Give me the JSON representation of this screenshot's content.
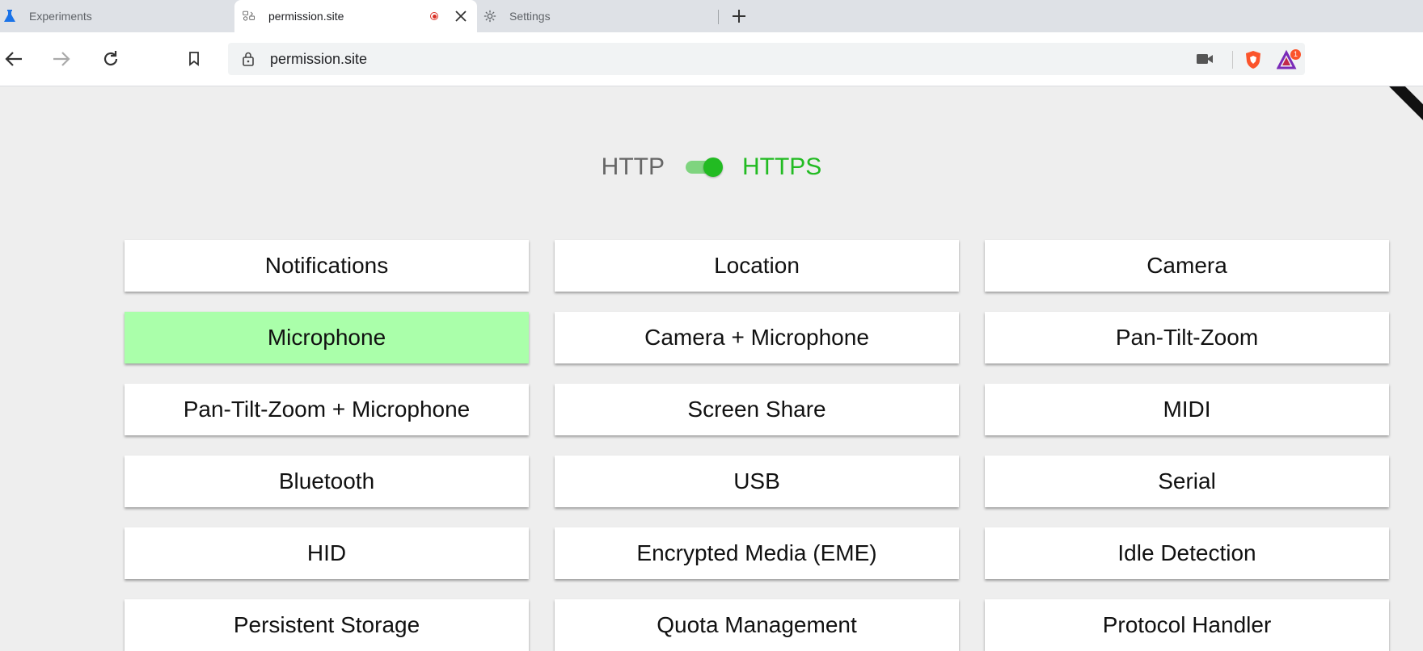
{
  "browser": {
    "tabs": [
      {
        "label": "Experiments",
        "icon": "flask-icon"
      },
      {
        "label": "permission.site",
        "icon": "site-icon",
        "active": true,
        "recording": true
      },
      {
        "label": "Settings",
        "icon": "gear-icon"
      }
    ],
    "address": "permission.site",
    "colors": {
      "recording": "#d93025",
      "brave": "#fb542b"
    },
    "rewards_badge": "1"
  },
  "page": {
    "protocol": {
      "http_label": "HTTP",
      "https_label": "HTTPS",
      "active": "HTTPS"
    },
    "accent_color": "#22bb22",
    "granted_color": "#aaffaa",
    "permissions": [
      {
        "label": "Notifications",
        "granted": false
      },
      {
        "label": "Location",
        "granted": false
      },
      {
        "label": "Camera",
        "granted": false
      },
      {
        "label": "Microphone",
        "granted": true
      },
      {
        "label": "Camera + Microphone",
        "granted": false
      },
      {
        "label": "Pan-Tilt-Zoom",
        "granted": false
      },
      {
        "label": "Pan-Tilt-Zoom + Microphone",
        "granted": false
      },
      {
        "label": "Screen Share",
        "granted": false
      },
      {
        "label": "MIDI",
        "granted": false
      },
      {
        "label": "Bluetooth",
        "granted": false
      },
      {
        "label": "USB",
        "granted": false
      },
      {
        "label": "Serial",
        "granted": false
      },
      {
        "label": "HID",
        "granted": false
      },
      {
        "label": "Encrypted Media (EME)",
        "granted": false
      },
      {
        "label": "Idle Detection",
        "granted": false
      },
      {
        "label": "Persistent Storage",
        "granted": false
      },
      {
        "label": "Quota Management",
        "granted": false
      },
      {
        "label": "Protocol Handler",
        "granted": false
      }
    ]
  }
}
